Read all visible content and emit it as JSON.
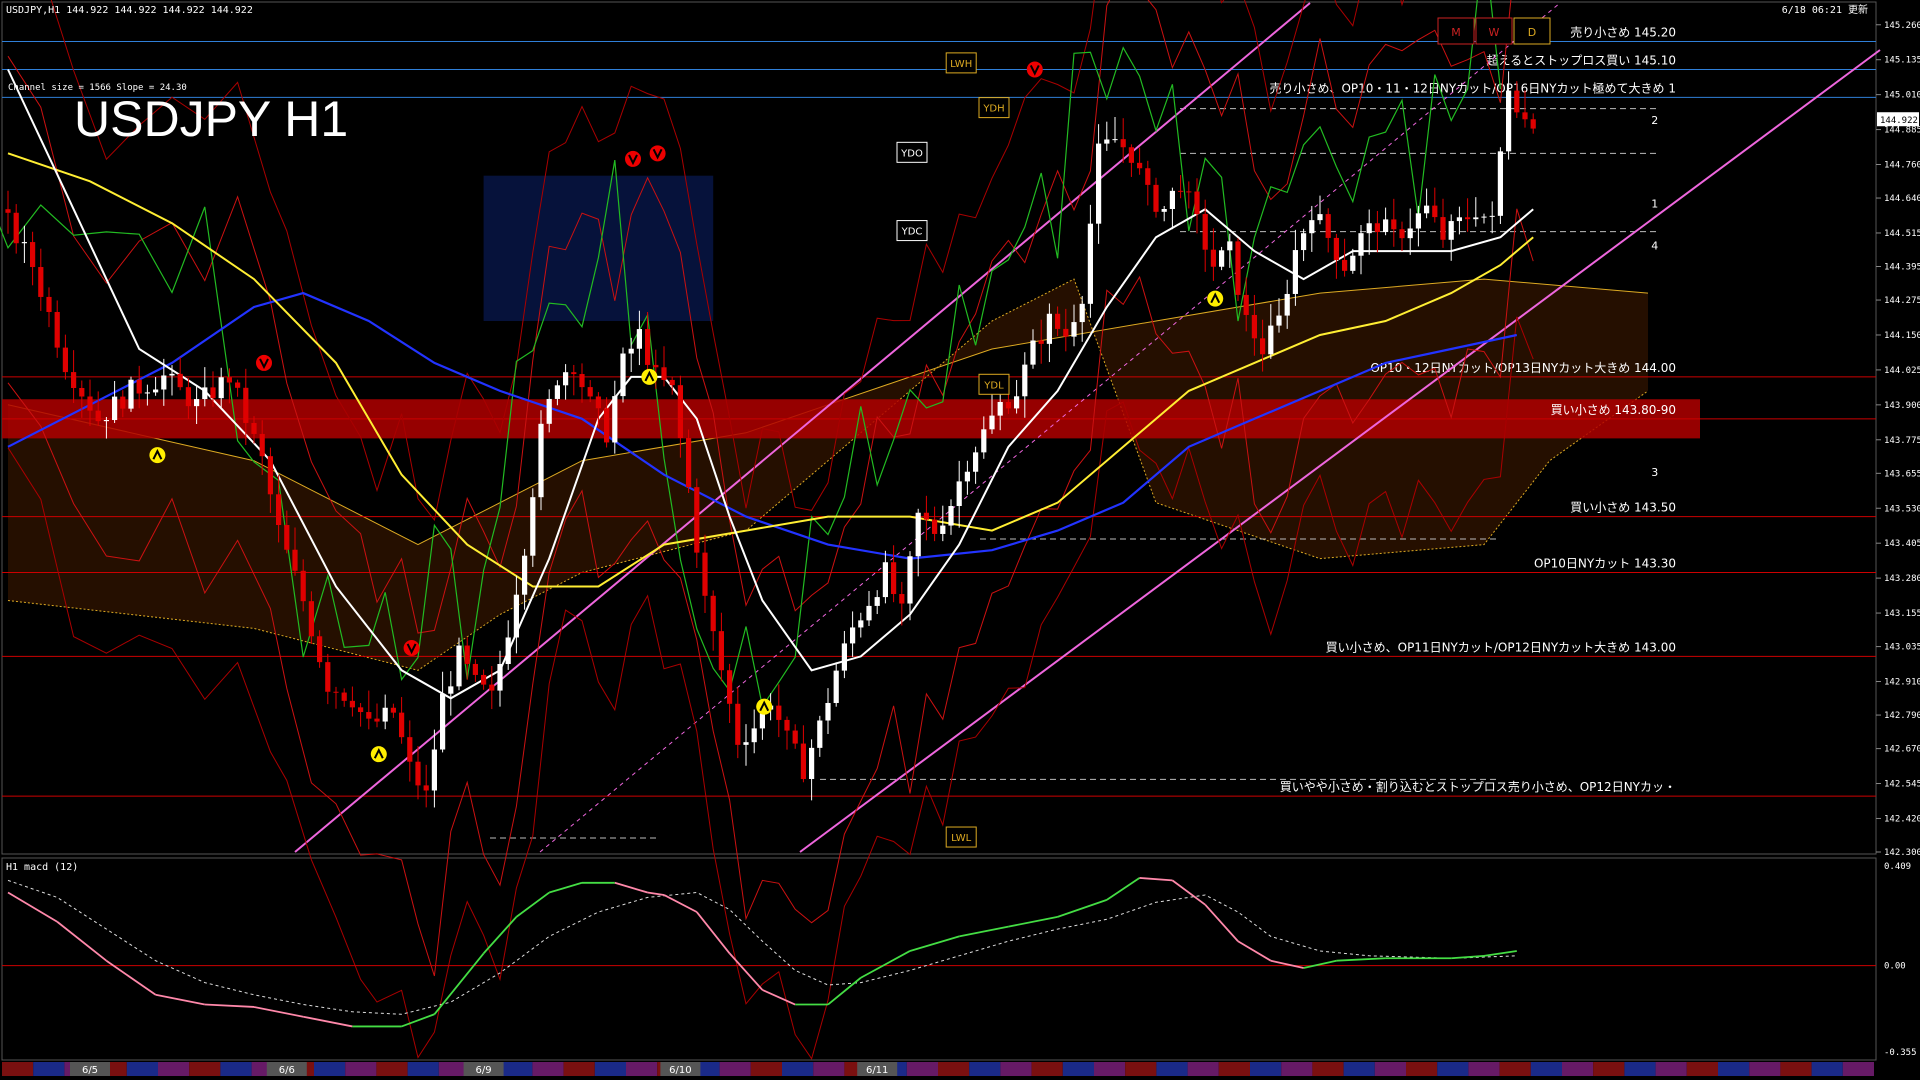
{
  "header": {
    "symbol_info": "USDJPY,H1  144.922 144.922 144.922 144.922",
    "channel_info": "Channel size = 1566 Slope = 24.30",
    "big_title": "USDJPY H1",
    "updated": "6/18 06:21 更新"
  },
  "colors": {
    "bg": "#000000",
    "candle_up": "#ffffff",
    "candle_down": "#e00000",
    "cloud": "#cc5500",
    "channel": "#ee66dd",
    "ma_white": "#ffffff",
    "ma_yellow": "#ffee33",
    "ma_blue": "#2233ff",
    "chikou_green": "#22bb22",
    "band_red": "#aa0000",
    "macd_main": "#ff88aa",
    "macd_pos": "#44dd44",
    "macd_signal": "#dddddd",
    "zone_highlight": "#b00000"
  },
  "chart_data": {
    "type": "candlestick",
    "timeframe": "H1",
    "ylim": [
      142.3,
      145.32
    ],
    "y_ticks": [
      "145.260",
      "145.135",
      "145.010",
      "144.885",
      "144.760",
      "144.640",
      "144.515",
      "144.395",
      "144.275",
      "144.150",
      "144.025",
      "143.900",
      "143.775",
      "143.655",
      "143.530",
      "143.405",
      "143.280",
      "143.155",
      "143.035",
      "142.910",
      "142.790",
      "142.670",
      "142.545",
      "142.420",
      "142.300"
    ],
    "current_price": "144.922",
    "x_dates": [
      {
        "label": "6/5",
        "bar": 10
      },
      {
        "label": "6/6",
        "bar": 34
      },
      {
        "label": "6/9",
        "bar": 58
      },
      {
        "label": "6/10",
        "bar": 82
      },
      {
        "label": "6/11",
        "bar": 106
      }
    ],
    "bars": 200,
    "close_path": [
      [
        0,
        144.6
      ],
      [
        4,
        144.4
      ],
      [
        8,
        144.05
      ],
      [
        12,
        143.85
      ],
      [
        16,
        143.95
      ],
      [
        20,
        144.0
      ],
      [
        24,
        143.9
      ],
      [
        28,
        144.0
      ],
      [
        32,
        143.7
      ],
      [
        34,
        143.45
      ],
      [
        37,
        143.2
      ],
      [
        40,
        142.9
      ],
      [
        43,
        142.85
      ],
      [
        45,
        142.75
      ],
      [
        48,
        142.8
      ],
      [
        50,
        142.6
      ],
      [
        52,
        142.5
      ],
      [
        54,
        142.85
      ],
      [
        56,
        143.0
      ],
      [
        58,
        142.9
      ],
      [
        60,
        142.85
      ],
      [
        62,
        143.1
      ],
      [
        64,
        143.4
      ],
      [
        66,
        143.8
      ],
      [
        68,
        144.0
      ],
      [
        70,
        144.05
      ],
      [
        72,
        143.9
      ],
      [
        74,
        143.8
      ],
      [
        76,
        144.05
      ],
      [
        78,
        144.15
      ],
      [
        80,
        144.0
      ],
      [
        82,
        143.95
      ],
      [
        84,
        143.6
      ],
      [
        86,
        143.2
      ],
      [
        88,
        142.95
      ],
      [
        90,
        142.7
      ],
      [
        92,
        142.75
      ],
      [
        94,
        142.85
      ],
      [
        96,
        142.7
      ],
      [
        98,
        142.6
      ],
      [
        100,
        142.75
      ],
      [
        102,
        142.95
      ],
      [
        104,
        143.1
      ],
      [
        106,
        143.2
      ],
      [
        108,
        143.3
      ],
      [
        110,
        143.15
      ],
      [
        112,
        143.5
      ],
      [
        114,
        143.45
      ],
      [
        116,
        143.55
      ],
      [
        118,
        143.7
      ],
      [
        120,
        143.8
      ],
      [
        122,
        143.9
      ],
      [
        124,
        143.95
      ],
      [
        126,
        144.1
      ],
      [
        128,
        144.2
      ],
      [
        130,
        144.15
      ],
      [
        132,
        144.3
      ],
      [
        134,
        144.8
      ],
      [
        136,
        144.85
      ],
      [
        138,
        144.8
      ],
      [
        140,
        144.65
      ],
      [
        142,
        144.6
      ],
      [
        144,
        144.7
      ],
      [
        146,
        144.55
      ],
      [
        148,
        144.4
      ],
      [
        150,
        144.45
      ],
      [
        152,
        144.2
      ],
      [
        154,
        144.1
      ],
      [
        156,
        144.2
      ],
      [
        158,
        144.45
      ],
      [
        160,
        144.6
      ],
      [
        162,
        144.5
      ],
      [
        164,
        144.4
      ],
      [
        166,
        144.5
      ],
      [
        168,
        144.55
      ],
      [
        170,
        144.5
      ],
      [
        172,
        144.55
      ],
      [
        174,
        144.6
      ],
      [
        176,
        144.5
      ],
      [
        178,
        144.55
      ],
      [
        180,
        144.6
      ],
      [
        182,
        144.55
      ],
      [
        184,
        145.05
      ],
      [
        186,
        144.92
      ]
    ],
    "ma_white": [
      [
        0,
        145.1
      ],
      [
        8,
        144.6
      ],
      [
        16,
        144.1
      ],
      [
        24,
        143.95
      ],
      [
        32,
        143.7
      ],
      [
        40,
        143.25
      ],
      [
        48,
        142.95
      ],
      [
        54,
        142.85
      ],
      [
        60,
        142.95
      ],
      [
        66,
        143.35
      ],
      [
        72,
        143.85
      ],
      [
        76,
        144.0
      ],
      [
        80,
        144.0
      ],
      [
        84,
        143.85
      ],
      [
        88,
        143.5
      ],
      [
        92,
        143.2
      ],
      [
        98,
        142.95
      ],
      [
        104,
        143.0
      ],
      [
        110,
        143.15
      ],
      [
        116,
        143.4
      ],
      [
        122,
        143.75
      ],
      [
        128,
        143.95
      ],
      [
        134,
        144.25
      ],
      [
        140,
        144.5
      ],
      [
        146,
        144.6
      ],
      [
        152,
        144.45
      ],
      [
        158,
        144.35
      ],
      [
        164,
        144.45
      ],
      [
        170,
        144.45
      ],
      [
        176,
        144.45
      ],
      [
        182,
        144.5
      ],
      [
        186,
        144.6
      ]
    ],
    "ma_yellow": [
      [
        0,
        144.8
      ],
      [
        10,
        144.7
      ],
      [
        20,
        144.55
      ],
      [
        30,
        144.35
      ],
      [
        40,
        144.05
      ],
      [
        48,
        143.65
      ],
      [
        56,
        143.4
      ],
      [
        64,
        143.25
      ],
      [
        72,
        143.25
      ],
      [
        80,
        143.4
      ],
      [
        90,
        143.45
      ],
      [
        100,
        143.5
      ],
      [
        110,
        143.5
      ],
      [
        120,
        143.45
      ],
      [
        128,
        143.55
      ],
      [
        136,
        143.75
      ],
      [
        144,
        143.95
      ],
      [
        152,
        144.05
      ],
      [
        160,
        144.15
      ],
      [
        168,
        144.2
      ],
      [
        176,
        144.3
      ],
      [
        182,
        144.4
      ],
      [
        186,
        144.5
      ]
    ],
    "ma_blue": [
      [
        0,
        143.75
      ],
      [
        10,
        143.9
      ],
      [
        20,
        144.05
      ],
      [
        30,
        144.25
      ],
      [
        36,
        144.3
      ],
      [
        44,
        144.2
      ],
      [
        52,
        144.05
      ],
      [
        60,
        143.95
      ],
      [
        70,
        143.85
      ],
      [
        80,
        143.65
      ],
      [
        90,
        143.5
      ],
      [
        100,
        143.4
      ],
      [
        110,
        143.35
      ],
      [
        120,
        143.38
      ],
      [
        128,
        143.45
      ],
      [
        136,
        143.55
      ],
      [
        144,
        143.75
      ],
      [
        152,
        143.85
      ],
      [
        160,
        143.95
      ],
      [
        168,
        144.05
      ],
      [
        176,
        144.1
      ],
      [
        184,
        144.15
      ]
    ],
    "price_lines": [
      {
        "price": 145.2,
        "color": "#2f7fd8",
        "label": "売り小さめ 145.20"
      },
      {
        "price": 145.1,
        "color": "#2f7fd8",
        "label": "超えるとストップロス買い 145.10"
      },
      {
        "price": 145.0,
        "color": "#2f7fd8",
        "label": "売り小さめ、OP10・11・12日NYカット/OP16日NYカット極めて大きめ 1"
      },
      {
        "price": 144.0,
        "color": "#cc0000",
        "label": "OP10・12日NYカット/OP13日NYカット大きめ 144.00"
      },
      {
        "price": 143.85,
        "color": "#cc0000",
        "label": "買い小さめ 143.80-90"
      },
      {
        "price": 143.5,
        "color": "#cc0000",
        "label": "買い小さめ 143.50"
      },
      {
        "price": 143.3,
        "color": "#cc0000",
        "label": "OP10日NYカット 143.30"
      },
      {
        "price": 143.0,
        "color": "#cc0000",
        "label": "買い小さめ、OP11日NYカット/OP12日NYカット大きめ 143.00"
      },
      {
        "price": 142.5,
        "color": "#cc0000",
        "label": "買いやや小さめ・割り込むとストップロス売り小さめ、OP12日NYカッ・"
      }
    ],
    "level_tags": [
      {
        "text": "LWH",
        "bar": 116,
        "price": 145.12
      },
      {
        "text": "YDH",
        "bar": 120,
        "price": 144.96
      },
      {
        "text": "YDO",
        "bar": 110,
        "price": 144.8
      },
      {
        "text": "YDC",
        "bar": 110,
        "price": 144.52
      },
      {
        "text": "YDL",
        "bar": 120,
        "price": 143.97
      },
      {
        "text": "LWL",
        "bar": 116,
        "price": 142.35
      }
    ],
    "mwd_labels": [
      "M",
      "W",
      "D"
    ],
    "wave_labels": [
      {
        "text": "1",
        "bar": 196,
        "price": 144.62
      },
      {
        "text": "2",
        "bar": 196,
        "price": 144.92
      },
      {
        "text": "3",
        "bar": 196,
        "price": 143.66
      },
      {
        "text": "4",
        "bar": 196,
        "price": 144.47
      }
    ],
    "macd": {
      "label": "H1  macd (12)",
      "ylim": [
        -0.355,
        0.409
      ],
      "y_ticks": [
        "0.409",
        "0.00",
        "-0.355"
      ],
      "main": [
        [
          0,
          0.3
        ],
        [
          6,
          0.18
        ],
        [
          12,
          0.02
        ],
        [
          18,
          -0.12
        ],
        [
          24,
          -0.16
        ],
        [
          30,
          -0.17
        ],
        [
          36,
          -0.21
        ],
        [
          42,
          -0.25
        ],
        [
          48,
          -0.25
        ],
        [
          52,
          -0.2
        ],
        [
          58,
          0.05
        ],
        [
          62,
          0.2
        ],
        [
          66,
          0.3
        ],
        [
          70,
          0.34
        ],
        [
          74,
          0.34
        ],
        [
          78,
          0.3
        ],
        [
          80,
          0.29
        ],
        [
          84,
          0.22
        ],
        [
          88,
          0.05
        ],
        [
          92,
          -0.1
        ],
        [
          96,
          -0.16
        ],
        [
          100,
          -0.16
        ],
        [
          104,
          -0.05
        ],
        [
          110,
          0.06
        ],
        [
          116,
          0.12
        ],
        [
          122,
          0.16
        ],
        [
          128,
          0.2
        ],
        [
          134,
          0.27
        ],
        [
          138,
          0.36
        ],
        [
          142,
          0.35
        ],
        [
          146,
          0.25
        ],
        [
          150,
          0.1
        ],
        [
          154,
          0.02
        ],
        [
          158,
          -0.01
        ],
        [
          162,
          0.02
        ],
        [
          168,
          0.03
        ],
        [
          176,
          0.03
        ],
        [
          180,
          0.04
        ],
        [
          184,
          0.06
        ]
      ],
      "signal": [
        [
          0,
          0.35
        ],
        [
          6,
          0.28
        ],
        [
          12,
          0.15
        ],
        [
          18,
          0.02
        ],
        [
          24,
          -0.07
        ],
        [
          30,
          -0.12
        ],
        [
          36,
          -0.16
        ],
        [
          42,
          -0.19
        ],
        [
          48,
          -0.2
        ],
        [
          54,
          -0.15
        ],
        [
          60,
          -0.03
        ],
        [
          66,
          0.12
        ],
        [
          72,
          0.22
        ],
        [
          78,
          0.28
        ],
        [
          84,
          0.3
        ],
        [
          88,
          0.23
        ],
        [
          92,
          0.1
        ],
        [
          96,
          -0.02
        ],
        [
          100,
          -0.08
        ],
        [
          104,
          -0.07
        ],
        [
          110,
          -0.02
        ],
        [
          116,
          0.04
        ],
        [
          122,
          0.1
        ],
        [
          128,
          0.15
        ],
        [
          134,
          0.19
        ],
        [
          140,
          0.26
        ],
        [
          146,
          0.29
        ],
        [
          150,
          0.22
        ],
        [
          154,
          0.12
        ],
        [
          160,
          0.06
        ],
        [
          166,
          0.04
        ],
        [
          176,
          0.03
        ],
        [
          184,
          0.04
        ]
      ]
    }
  }
}
